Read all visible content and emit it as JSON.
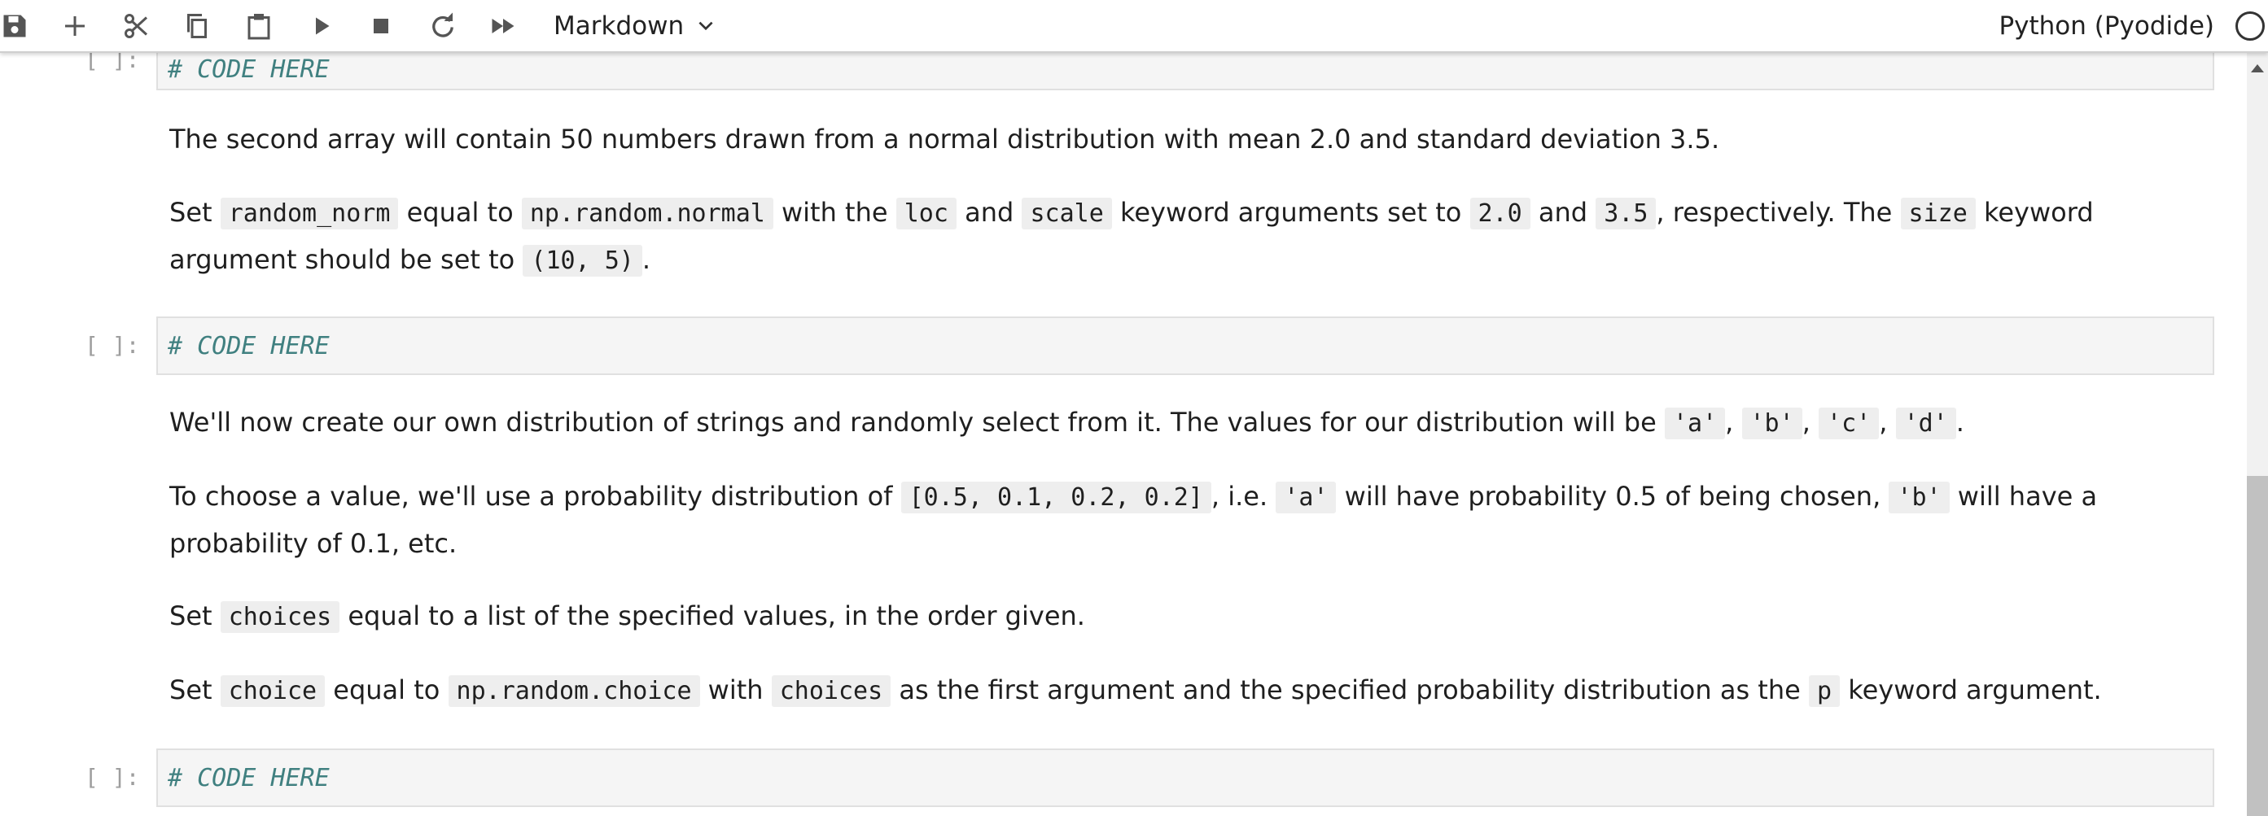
{
  "toolbar": {
    "cell_type": "Markdown",
    "kernel": "Python (Pyodide)"
  },
  "cells": {
    "code1": {
      "prompt": "[ ]:",
      "code": "# CODE HERE"
    },
    "md1": "The second array will contain 50 numbers drawn from a normal distribution with mean 2.0 and standard deviation 3.5.",
    "md2": {
      "t1": "Set",
      "c1": "random_norm",
      "t2": "equal to",
      "c2": "np.random.normal",
      "t3": "with the",
      "c3": "loc",
      "t4": "and",
      "c4": "scale",
      "t5": "keyword arguments set to",
      "c5": "2.0",
      "t6": "and",
      "c6": "3.5",
      "t7": ", respectively. The",
      "c7": "size",
      "t8": "keyword argument should be set to",
      "c8": "(10, 5)",
      "t9": "."
    },
    "code2": {
      "prompt": "[ ]:",
      "code": "# CODE HERE"
    },
    "md3": {
      "t1": "We'll now create our own distribution of strings and randomly select from it. The values for our distribution will be",
      "c1": "'a'",
      "t2": ",",
      "c2": "'b'",
      "t3": ",",
      "c3": "'c'",
      "t4": ",",
      "c4": "'d'",
      "t5": "."
    },
    "md4": {
      "t1": "To choose a value, we'll use a probability distribution of",
      "c1": "[0.5, 0.1, 0.2, 0.2]",
      "t2": ", i.e.",
      "c2": "'a'",
      "t3": "will have probability 0.5 of being chosen,",
      "c3": "'b'",
      "t4": "will have a probability of 0.1, etc."
    },
    "md5": {
      "t1": "Set",
      "c1": "choices",
      "t2": "equal to a list of the specified values, in the order given."
    },
    "md6": {
      "t1": "Set",
      "c1": "choice",
      "t2": "equal to",
      "c2": "np.random.choice",
      "t3": "with",
      "c3": "choices",
      "t4": "as the first argument and the specified probability distribution as the",
      "c4": "p",
      "t5": "keyword argument."
    },
    "code3": {
      "prompt": "[ ]:",
      "code": "# CODE HERE"
    }
  }
}
